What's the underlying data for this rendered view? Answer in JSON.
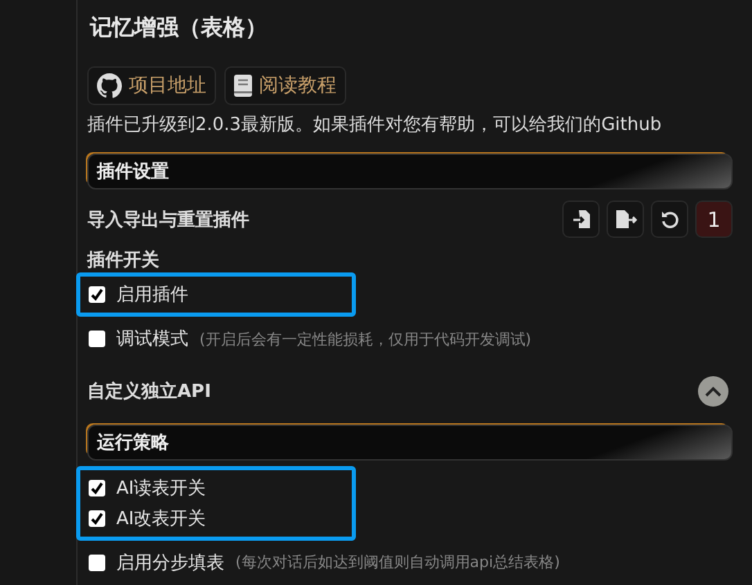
{
  "title": "记忆增强（表格）",
  "links": [
    {
      "kind": "github",
      "label": "项目地址"
    },
    {
      "kind": "book",
      "label": "阅读教程"
    }
  ],
  "notice": "插件已升级到2.0.3最新版。如果插件对您有帮助，可以给我们的Github",
  "plugin_settings": {
    "header": "插件设置",
    "import_row": {
      "label": "导入导出与重置插件",
      "actions": [
        {
          "kind": "import"
        },
        {
          "kind": "export"
        },
        {
          "kind": "reset"
        },
        {
          "kind": "text",
          "label": "1"
        }
      ]
    },
    "switch_heading": "插件开关",
    "switch_groups": [
      {
        "highlighted": true,
        "items": [
          {
            "label": "启用插件",
            "checked": true
          }
        ]
      },
      {
        "highlighted": false,
        "items": [
          {
            "label": "调试模式",
            "note": "(开启后会有一定性能损耗，仅用于代码开发调试)",
            "checked": false
          }
        ]
      }
    ],
    "api_row": {
      "label": "自定义独立API",
      "expanded": true
    }
  },
  "run_strategy": {
    "header": "运行策略",
    "groups": [
      {
        "highlighted": true,
        "items": [
          {
            "label": "AI读表开关",
            "checked": true
          },
          {
            "label": "AI改表开关",
            "checked": true
          }
        ]
      },
      {
        "highlighted": false,
        "items": [
          {
            "label": "启用分步填表",
            "note": "(每次对话后如达到阈值则自动调用api总结表格)",
            "checked": false
          }
        ]
      }
    ]
  }
}
